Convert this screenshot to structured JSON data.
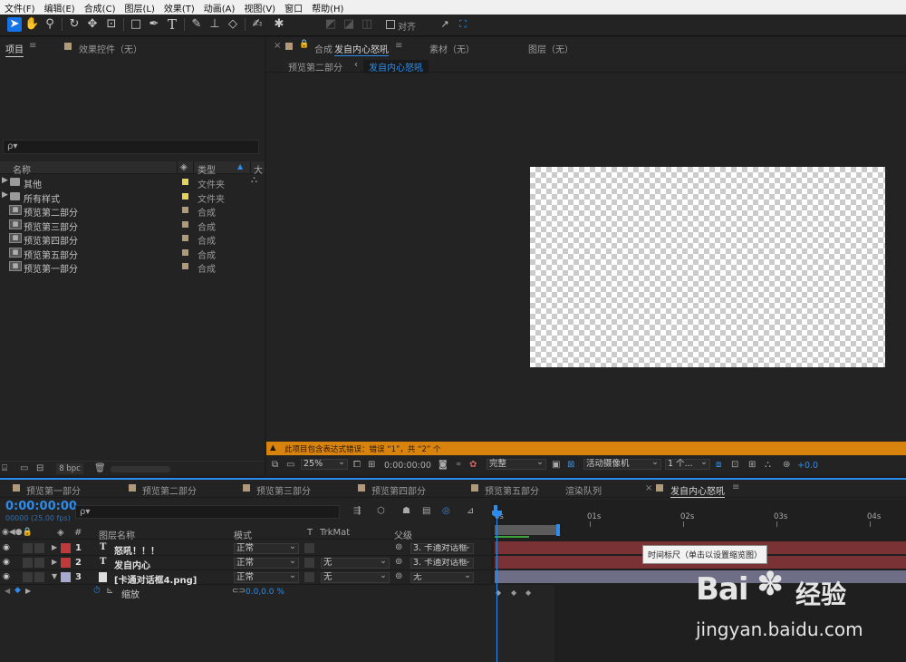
{
  "menu": [
    "文件(F)",
    "编辑(E)",
    "合成(C)",
    "图层(L)",
    "效果(T)",
    "动画(A)",
    "视图(V)",
    "窗口",
    "帮助(H)"
  ],
  "toolbar": {
    "align_label": "对齐"
  },
  "project": {
    "tab_project": "项目",
    "tab_effects": "效果控件（无）",
    "search_placeholder": "ρ▾",
    "col_name": "名称",
    "col_type": "类型",
    "col_size": "大",
    "items": [
      {
        "name": "其他",
        "type": "文件夹",
        "kind": "folder",
        "label_color": "#e6d35a"
      },
      {
        "name": "所有样式",
        "type": "文件夹",
        "kind": "folder",
        "label_color": "#e6d35a"
      },
      {
        "name": "预览第二部分",
        "type": "合成",
        "kind": "comp",
        "label_color": "#b09a7a"
      },
      {
        "name": "预览第三部分",
        "type": "合成",
        "kind": "comp",
        "label_color": "#b09a7a"
      },
      {
        "name": "预览第四部分",
        "type": "合成",
        "kind": "comp",
        "label_color": "#b09a7a"
      },
      {
        "name": "预览第五部分",
        "type": "合成",
        "kind": "comp",
        "label_color": "#b09a7a"
      },
      {
        "name": "预览第一部分",
        "type": "合成",
        "kind": "comp",
        "label_color": "#b09a7a"
      }
    ],
    "bpc": "8 bpc"
  },
  "viewer": {
    "tab_comp_prefix": "合成",
    "tab_comp_name": "发自内心怒吼",
    "tab_footage": "素材（无）",
    "tab_layer": "图层（无）",
    "breadcrumb_prev": "预览第二部分",
    "breadcrumb_current": "发自内心怒吼",
    "warning": "此项目包含表达式错误：错误 “1”，共 “2” 个",
    "zoom": "25%",
    "timecode": "0:00:00:00",
    "resolution": "完整",
    "camera": "活动摄像机",
    "views": "1 个...",
    "exposure": "+0.0"
  },
  "timeline": {
    "tabs": [
      "预览第一部分",
      "预览第二部分",
      "预览第三部分",
      "预览第四部分",
      "预览第五部分",
      "渲染队列",
      "发自内心怒吼"
    ],
    "timecode": "0:00:00:00",
    "fps": "00000 (25.00 fps)",
    "col_layer_name": "图层名称",
    "col_mode": "模式",
    "col_t": "T",
    "col_trkmat": "TrkMat",
    "col_parent": "父级",
    "ruler": [
      "0s",
      "01s",
      "02s",
      "03s",
      "04s"
    ],
    "tooltip": "时间标尺（单击以设置缩览图）",
    "layers": [
      {
        "num": "1",
        "type": "T",
        "name": "怒吼！！！",
        "mode": "正常",
        "trkmat": "",
        "parent": "3. 卡通对话框",
        "color": "#c0393b",
        "bar": "#7a3234"
      },
      {
        "num": "2",
        "type": "T",
        "name": "发自内心",
        "mode": "正常",
        "trkmat": "无",
        "parent": "3. 卡通对话框",
        "color": "#c0393b",
        "bar": "#7a3234"
      },
      {
        "num": "3",
        "type": "img",
        "name": "[卡通对话框4.png]",
        "mode": "正常",
        "trkmat": "无",
        "parent": "无",
        "color": "#a9a9cf",
        "bar": "#6e6e86"
      }
    ],
    "prop_name": "缩放",
    "prop_value": "0.0,0.0 %"
  },
  "watermark": {
    "brand": "Bai",
    "brand2": "经验",
    "url": "jingyan.baidu.com"
  }
}
